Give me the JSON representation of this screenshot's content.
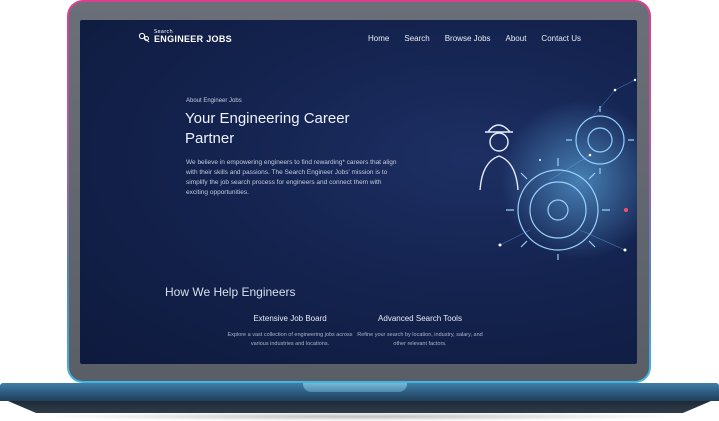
{
  "brand": {
    "logo_small": "Search",
    "logo_big": "ENGINEER JOBS"
  },
  "nav": {
    "items": [
      {
        "label": "Home"
      },
      {
        "label": "Search"
      },
      {
        "label": "Browse Jobs"
      },
      {
        "label": "About"
      },
      {
        "label": "Contact Us"
      }
    ]
  },
  "hero": {
    "eyebrow": "About Engineer Jobs",
    "title": "Your Engineering Career Partner",
    "body": "We believe in empowering engineers to find rewarding* careers that align with their skills and passions. The Search Engineer Jobs' mission is to simplify the job search process for engineers and connect them with exciting opportunities."
  },
  "help": {
    "title": "How We Help Engineers",
    "features": [
      {
        "title": "Extensive Job Board",
        "text": "Explore a vast collection of engineering jobs across various industries and locations."
      },
      {
        "title": "Advanced Search Tools",
        "text": "Refine your search by location, industry, salary, and other relevant factors."
      }
    ]
  },
  "colors": {
    "screen_bg": "#14234f",
    "frame_accent_top": "#dd3f8f",
    "frame_accent_bottom": "#3fb6e0",
    "illustration_glow": "#4fb3ff"
  },
  "icons": [
    "logo-mark-icon",
    "engineer-gears-illustration"
  ]
}
